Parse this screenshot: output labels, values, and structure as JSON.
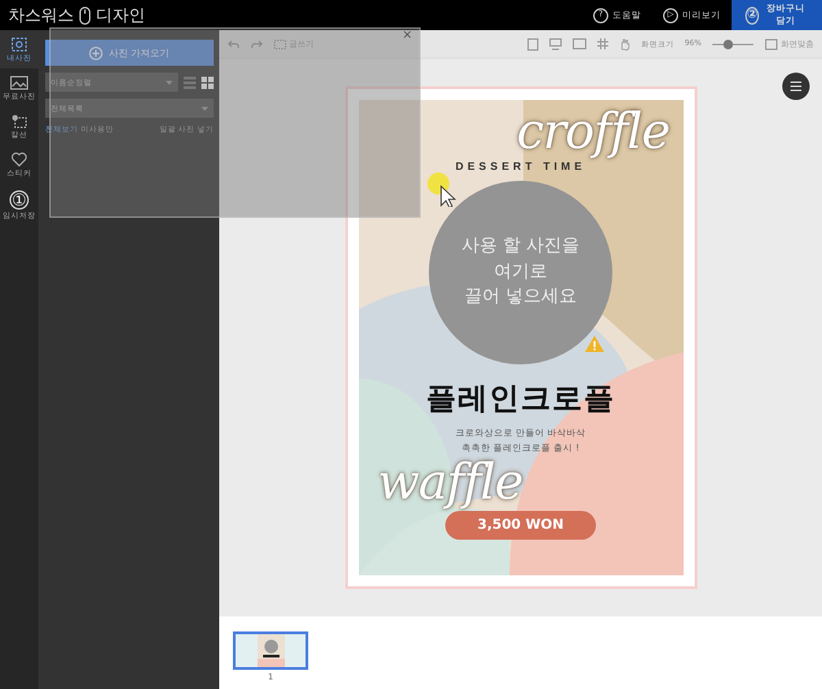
{
  "top_bar": {
    "logo_left": "차스워스",
    "logo_right": "디자인",
    "actions": [
      {
        "kind": "help",
        "label": "도움말",
        "badge": "?"
      },
      {
        "kind": "preview",
        "label": "미리보기",
        "badge": "▷"
      },
      {
        "kind": "cart",
        "label": "장바구니 담기",
        "badge": "②"
      }
    ]
  },
  "sidebar": {
    "items": [
      {
        "kind": "photo",
        "label": "내사진",
        "selected": true
      },
      {
        "kind": "free",
        "label": "무료사진",
        "selected": false
      },
      {
        "kind": "cut",
        "label": "칼선",
        "selected": false
      },
      {
        "kind": "heart",
        "label": "스티커",
        "selected": false
      },
      {
        "kind": "badge",
        "label": "임시저장",
        "badge": "①",
        "selected": false
      }
    ]
  },
  "panel": {
    "upload_button": "사진 가져오기",
    "sort_select": "이름순정렬",
    "folder_select": "전체목록",
    "view_modes": [
      {
        "kind": "list",
        "selected": false
      },
      {
        "kind": "grid",
        "selected": true
      }
    ],
    "filters": [
      {
        "label": "전체보기",
        "selected": true
      },
      {
        "label": "미사용만",
        "selected": false
      }
    ],
    "bulk_link": "일괄 사진 넣기"
  },
  "dialog": {
    "close": "×"
  },
  "toolbar": {
    "write_button": "글쓰기",
    "zoom_label": "화면크기",
    "zoom_value": "96%",
    "zoom": {
      "level": 0.35
    },
    "fit_button": "화면맞춤"
  },
  "poster": {
    "subtitle": "DESSERT TIME",
    "script_top": "croffle",
    "script_bottom": "waffle",
    "dropzone_text": "사용 할 사진을\n여기로\n끌어 넣으세요",
    "title": "플레인크로플",
    "description": [
      "크로와상으로 만들어 바삭바삭",
      "촉촉한 플레인크로플 출시 !"
    ],
    "price": "3,500 WON"
  },
  "pages": [
    {
      "number": "1",
      "selected": true
    }
  ]
}
